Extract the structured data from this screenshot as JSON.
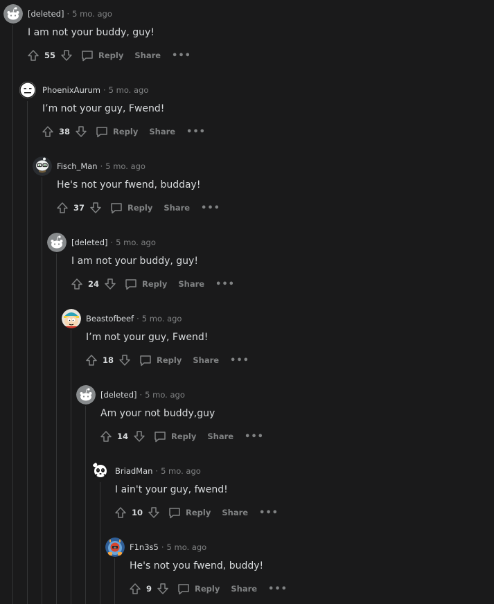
{
  "thread": {
    "comments": [
      {
        "author": "[deleted]",
        "time": "5 mo. ago",
        "text": "I am not your buddy, guy!",
        "score": "55",
        "avatar": "deleted-avatar"
      },
      {
        "author": "PhoenixAurum",
        "time": "5 mo. ago",
        "text": "I’m not your guy, Fwend!",
        "score": "38",
        "avatar": "neutral-face-avatar"
      },
      {
        "author": "Fisch_Man",
        "time": "5 mo. ago",
        "text": "He's not your fwend, budday!",
        "score": "37",
        "avatar": "snoo-glasses-avatar"
      },
      {
        "author": "[deleted]",
        "time": "5 mo. ago",
        "text": "I am not your buddy, guy!",
        "score": "24",
        "avatar": "deleted-avatar"
      },
      {
        "author": "Beastofbeef",
        "time": "5 mo. ago",
        "text": "I’m not your guy, Fwend!",
        "score": "18",
        "avatar": "cartman-avatar"
      },
      {
        "author": "[deleted]",
        "time": "5 mo. ago",
        "text": "Am your not buddy,guy",
        "score": "14",
        "avatar": "deleted-avatar"
      },
      {
        "author": "BriadMan",
        "time": "5 mo. ago",
        "text": "I ain't your guy, fwend!",
        "score": "10",
        "avatar": "panda-avatar"
      },
      {
        "author": "F1n3s5",
        "time": "5 mo. ago",
        "text": "He's not you fwend, buddy!",
        "score": "9",
        "avatar": "robot-avatar"
      }
    ],
    "labels": {
      "reply": "Reply",
      "share": "Share",
      "more": "•••",
      "dot": "·"
    },
    "colors": {
      "background": "#1a1a1b",
      "text": "#d7dadc",
      "muted": "#818384",
      "thread_line": "#343536"
    }
  }
}
